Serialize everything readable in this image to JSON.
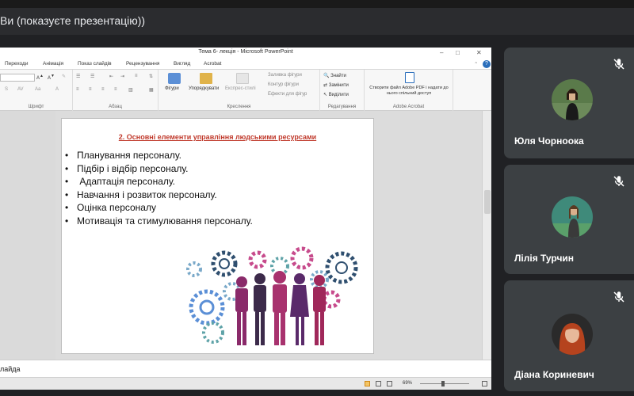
{
  "meeting": {
    "presenting_label": "Ви (показуєте презентацію))"
  },
  "powerpoint": {
    "window_title": "Тема 6- лекція  -  Microsoft PowerPoint",
    "window_controls": [
      "–",
      "□",
      "✕"
    ],
    "ribbon_tabs": [
      "Переходи",
      "Анімація",
      "Показ слайдів",
      "Рецензування",
      "Вигляд",
      "Acrobat"
    ],
    "ribbon_groups": {
      "font_label": "Шрифт",
      "paragraph_label": "Абзац",
      "drawing_label": "Креслення",
      "editing_label": "Редагування",
      "acrobat_label": "Adobe Acrobat"
    },
    "ribbon_buttons": {
      "shapes": "Фігури",
      "arrange": "Упорядкувати",
      "quick_styles": "Експрес-стилі",
      "shape_fill": "Заливка фігури",
      "shape_outline": "Контур фігури",
      "shape_effects": "Ефекти для фігур",
      "find": "Знайти",
      "replace": "Замінити",
      "select": "Виділити",
      "create_pdf": "Створити файл Adobe PDF і надати до нього спільний доступ"
    },
    "slide": {
      "title": "2. Основні елементи управління людськими ресурсами",
      "bullets": [
        "Планування персоналу.",
        "Підбір і відбір персоналу.",
        " Адаптація персоналу.",
        "Навчання і розвиток персоналу.",
        "Оцінка персоналу",
        "Мотивація та стимулювання персоналу."
      ]
    },
    "notes_text": "лайда",
    "zoom_level": "69%"
  },
  "participants": [
    {
      "name": "Юля Чорноока",
      "muted": true
    },
    {
      "name": "Лілія Турчин",
      "muted": true
    },
    {
      "name": "Діана Кориневич",
      "muted": true
    }
  ],
  "colors": {
    "meet_bg": "#202124",
    "tile_bg": "#3c4043",
    "slide_title_red": "#c0392b"
  }
}
